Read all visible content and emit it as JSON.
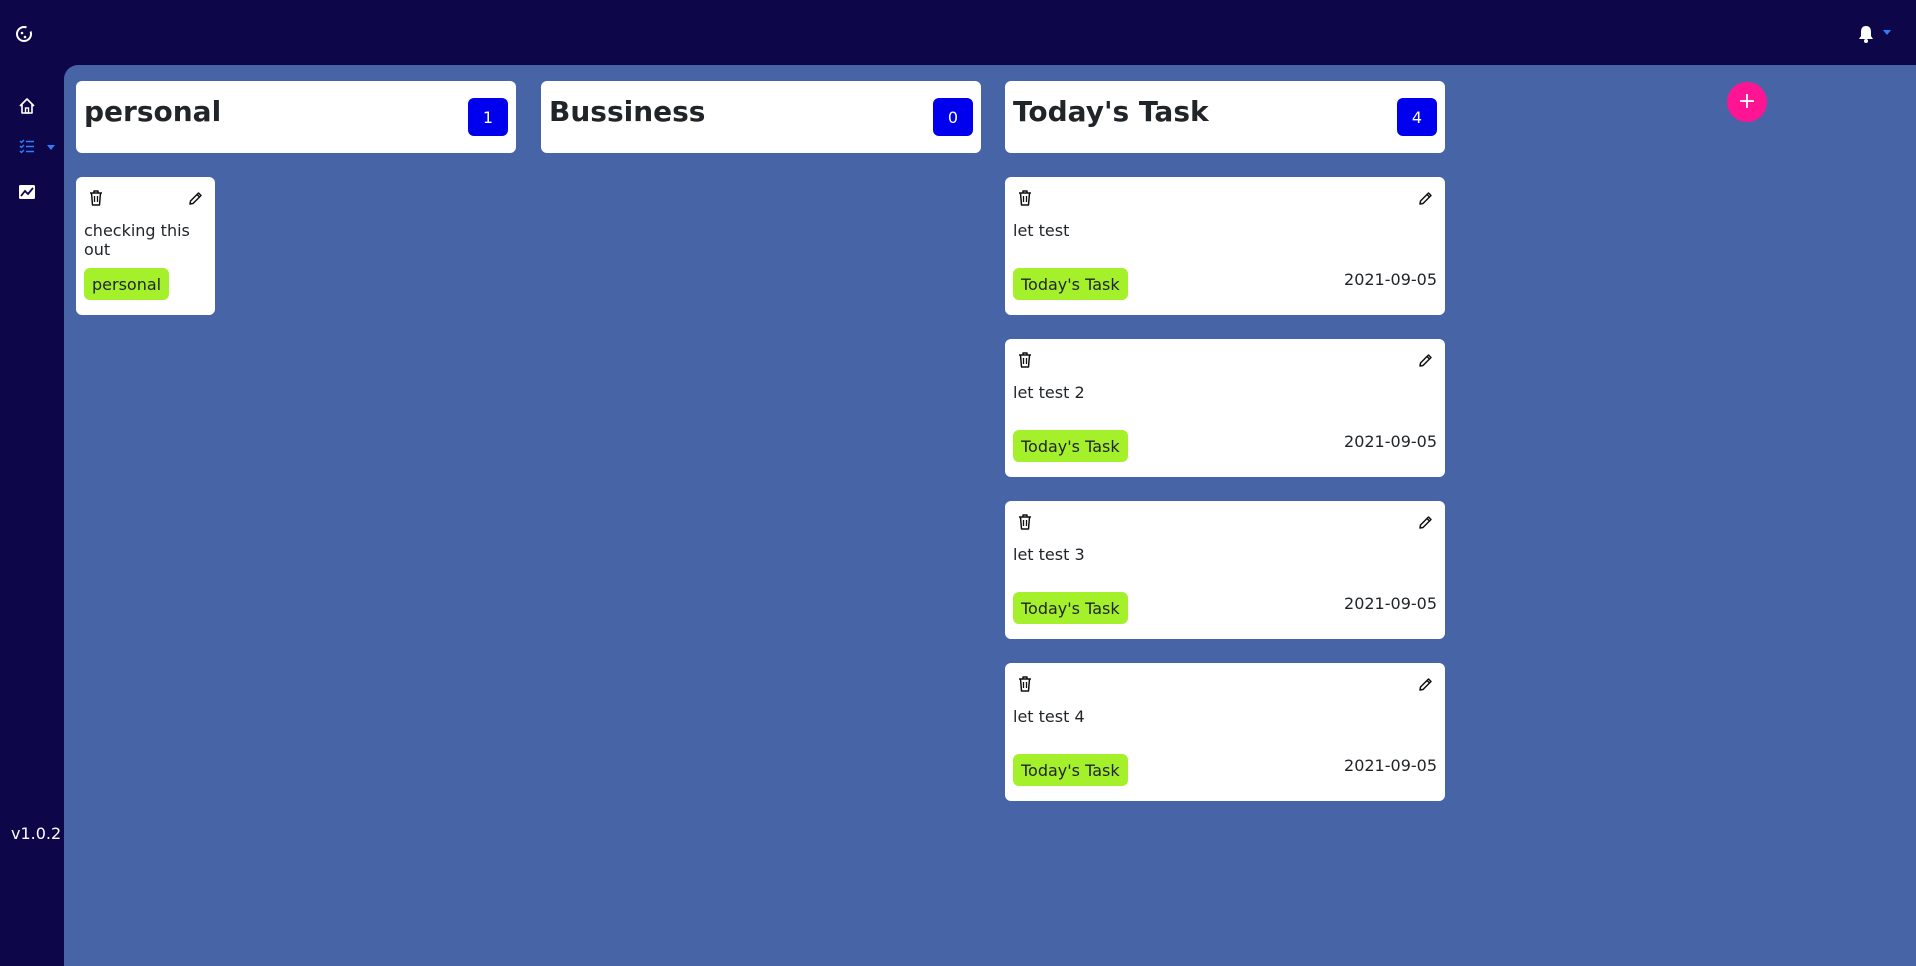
{
  "app": {
    "logo_icon": "cookie-icon",
    "version": "v1.0.2",
    "accent": "#2f7dff",
    "background": "#0d0648",
    "board_background": "#4764a6"
  },
  "header": {
    "bell_icon": "bell-icon"
  },
  "sidebar": {
    "items": [
      {
        "icon": "home-icon"
      },
      {
        "icon": "list-icon"
      },
      {
        "icon": "chart-icon"
      }
    ]
  },
  "add_button": {
    "label": "+",
    "color": "#ff1493"
  },
  "columns": [
    {
      "title": "personal",
      "count": "1",
      "cards": [
        {
          "text": "checking this out",
          "tag": "personal",
          "date": ""
        }
      ]
    },
    {
      "title": "Bussiness",
      "count": "0",
      "cards": []
    },
    {
      "title": "Today's Task",
      "count": "4",
      "cards": [
        {
          "text": "let test",
          "tag": "Today's Task",
          "date": "2021-09-05"
        },
        {
          "text": "let test 2",
          "tag": "Today's Task",
          "date": "2021-09-05"
        },
        {
          "text": "let test 3",
          "tag": "Today's Task",
          "date": "2021-09-05"
        },
        {
          "text": "let test 4",
          "tag": "Today's Task",
          "date": "2021-09-05"
        }
      ]
    }
  ],
  "colors": {
    "badge": "#0000ee",
    "tag": "#a4f02b"
  }
}
